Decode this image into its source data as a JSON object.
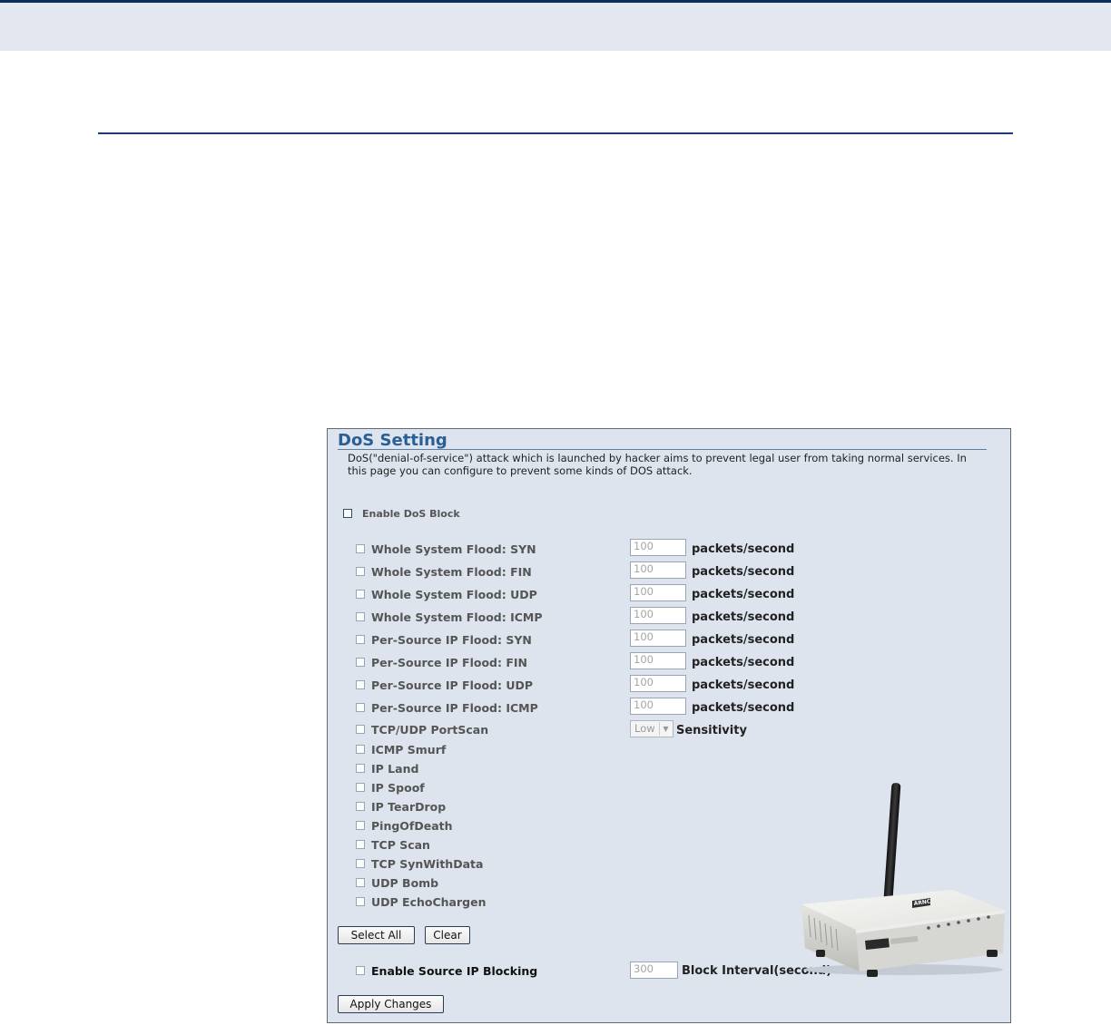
{
  "panel": {
    "title": "DoS Setting",
    "description": "DoS(\"denial-of-service\") attack which is launched by hacker aims to prevent legal user from taking normal services. In this page you can configure to prevent some kinds of DOS attack.",
    "enable_label": "Enable DoS Block",
    "floods": [
      {
        "label": "Whole System Flood: SYN",
        "value": "100",
        "unit": "packets/second"
      },
      {
        "label": "Whole System Flood: FIN",
        "value": "100",
        "unit": "packets/second"
      },
      {
        "label": "Whole System Flood: UDP",
        "value": "100",
        "unit": "packets/second"
      },
      {
        "label": "Whole System Flood: ICMP",
        "value": "100",
        "unit": "packets/second"
      },
      {
        "label": "Per-Source IP Flood: SYN",
        "value": "100",
        "unit": "packets/second"
      },
      {
        "label": "Per-Source IP Flood: FIN",
        "value": "100",
        "unit": "packets/second"
      },
      {
        "label": "Per-Source IP Flood: UDP",
        "value": "100",
        "unit": "packets/second"
      },
      {
        "label": "Per-Source IP Flood: ICMP",
        "value": "100",
        "unit": "packets/second"
      }
    ],
    "portscan": {
      "label": "TCP/UDP PortScan",
      "sensitivity_value": "Low",
      "sensitivity_label": "Sensitivity"
    },
    "attacks": [
      "ICMP Smurf",
      "IP Land",
      "IP Spoof",
      "IP TearDrop",
      "PingOfDeath",
      "TCP Scan",
      "TCP SynWithData",
      "UDP Bomb",
      "UDP EchoChargen"
    ],
    "select_all": "Select All",
    "clear": "Clear",
    "source_block": {
      "label": "Enable Source IP Blocking",
      "value": "300",
      "unit": "Block Interval(second)"
    },
    "apply": "Apply Changes",
    "router_brand": "ARNC"
  }
}
